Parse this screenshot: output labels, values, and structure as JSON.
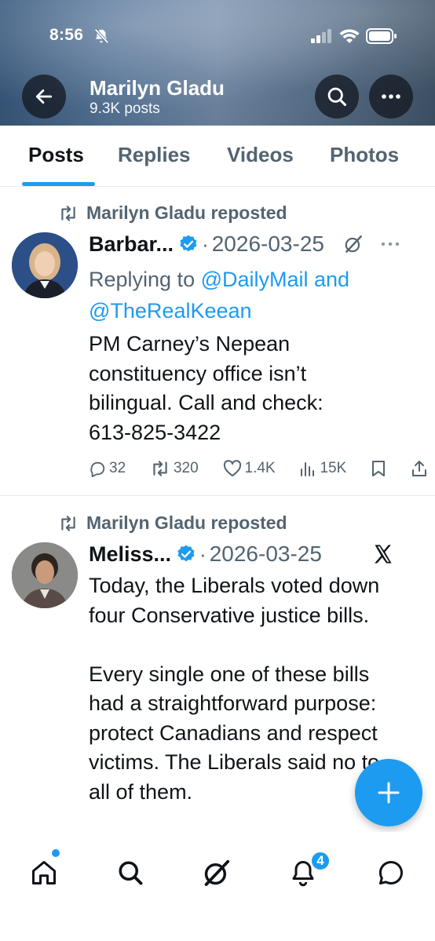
{
  "status_bar": {
    "time": "8:56"
  },
  "header": {
    "profile_name": "Marilyn Gladu",
    "post_count": "9.3K posts"
  },
  "tabs": [
    {
      "label": "Posts",
      "active": true
    },
    {
      "label": "Replies",
      "active": false
    },
    {
      "label": "Videos",
      "active": false
    },
    {
      "label": "Photos",
      "active": false
    }
  ],
  "posts": [
    {
      "repost_label": "Marilyn Gladu reposted",
      "author": "Barbar...",
      "separator": "·",
      "date": "2026-03-25",
      "reply_prefix": "Replying to ",
      "reply_mention_1": "@DailyMail and",
      "reply_mention_2": "@TheRealKeean",
      "text": "PM Carney’s Nepean\nconstituency office isn’t\nbilingual. Call and check:\n613-825-3422",
      "stats": {
        "replies": "32",
        "reposts": "320",
        "likes": "1.4K",
        "views": "15K"
      }
    },
    {
      "repost_label": "Marilyn Gladu reposted",
      "author": "Meliss...",
      "separator": "·",
      "date": "2026-03-25",
      "text": "Today, the Liberals voted down\nfour Conservative justice bills.\n\nEvery single one of these bills\nhad a straightforward purpose:\nprotect Canadians and respect\nvictims. The Liberals said no to\nall of them."
    }
  ],
  "bottom_nav": {
    "notifications_badge": "4"
  },
  "colors": {
    "accent": "#1d9bf0",
    "text": "#0f1419",
    "muted": "#536471"
  },
  "icons": {
    "back": "arrow-left-icon",
    "search": "search-icon",
    "more": "more-icon",
    "repost": "repost-icon",
    "verified": "verified-badge-icon",
    "grok": "grok-icon",
    "x_logo": "x-logo-icon",
    "reply": "reply-icon",
    "like": "heart-icon",
    "views": "views-icon",
    "bookmark": "bookmark-icon",
    "share": "share-icon",
    "compose": "plus-icon",
    "home": "home-icon",
    "notifications": "bell-icon",
    "messages": "message-icon"
  }
}
